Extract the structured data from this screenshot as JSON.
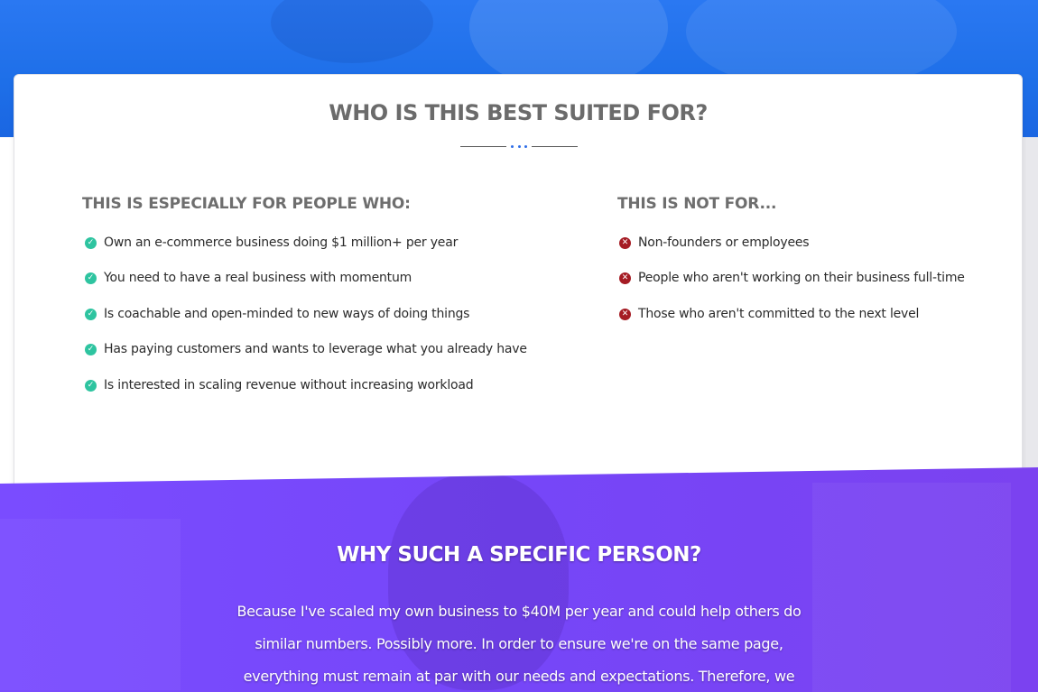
{
  "section": {
    "title": "WHO IS THIS BEST SUITED FOR?"
  },
  "for_column": {
    "heading": "THIS IS ESPECIALLY FOR PEOPLE WHO:",
    "icon": "check-circle-icon",
    "icon_color": "#2ec4a0",
    "items": [
      "Own an e-commerce business doing $1 million+ per year",
      "You need to have a real business with momentum",
      "Is coachable and open-minded to new ways of doing things",
      "Has paying customers and wants to leverage what you already have",
      "Is interested in scaling revenue without increasing workload"
    ]
  },
  "not_column": {
    "heading": "THIS IS NOT FOR...",
    "icon": "times-circle-icon",
    "icon_color": "#a51c24",
    "items": [
      "Non-founders or employees",
      "People who aren't working on their business full-time",
      "Those who aren't committed to the next level"
    ]
  },
  "why_section": {
    "title": "WHY SUCH A SPECIFIC PERSON?",
    "body": "Because I've scaled my own business to $40M per year and could help others do similar numbers. Possibly more. In order to ensure we're on the same page, everything must remain at par with our needs and expectations. Therefore, we"
  },
  "colors": {
    "hero_blue": "#1e6fe8",
    "accent_blue": "#2f6ee8",
    "band_purple": "#7646f8",
    "heading_gray": "#6b6b6b"
  }
}
